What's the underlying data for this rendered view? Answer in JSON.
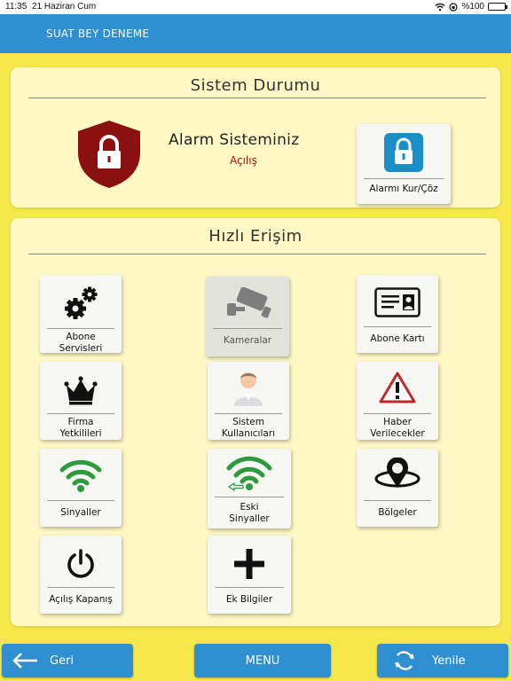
{
  "status_bar": {
    "time": "11:35",
    "date": "21 Haziran Cum",
    "battery": "%100"
  },
  "app": {
    "title": "SUAT BEY DENEME"
  },
  "system_status": {
    "title": "Sistem Durumu",
    "alarm_title": "Alarm Sisteminiz",
    "alarm_state": "Açılış",
    "toggle_label": "Alarmı Kur/Çöz"
  },
  "quick_access": {
    "title": "Hızlı Erişim",
    "items": [
      {
        "label": "Abone\nServisleri",
        "icon": "gears-icon"
      },
      {
        "label": "Kameralar",
        "icon": "camera-icon"
      },
      {
        "label": "Abone Kartı",
        "icon": "id-card-icon"
      },
      {
        "label": "Firma\nYetkilileri",
        "icon": "crown-icon"
      },
      {
        "label": "Sistem\nKullanıcıları",
        "icon": "user-icon"
      },
      {
        "label": "Haber\nVerilecekler",
        "icon": "warning-icon"
      },
      {
        "label": "Sinyaller",
        "icon": "wifi-icon"
      },
      {
        "label": "Eski\nSinyaller",
        "icon": "wifi-back-icon"
      },
      {
        "label": "Bölgeler",
        "icon": "zone-icon"
      },
      {
        "label": "Açılış Kapanış",
        "icon": "power-icon"
      },
      {
        "label": "Ek Bilgiler",
        "icon": "plus-icon"
      }
    ]
  },
  "nav": {
    "back": "Geri",
    "menu": "MENU",
    "refresh": "Yenile"
  },
  "colors": {
    "primary": "#2f8fd0",
    "background": "#f5e84a",
    "panel": "#fff8c5",
    "alarm": "#8b1010",
    "signal": "#2e9a3e"
  }
}
